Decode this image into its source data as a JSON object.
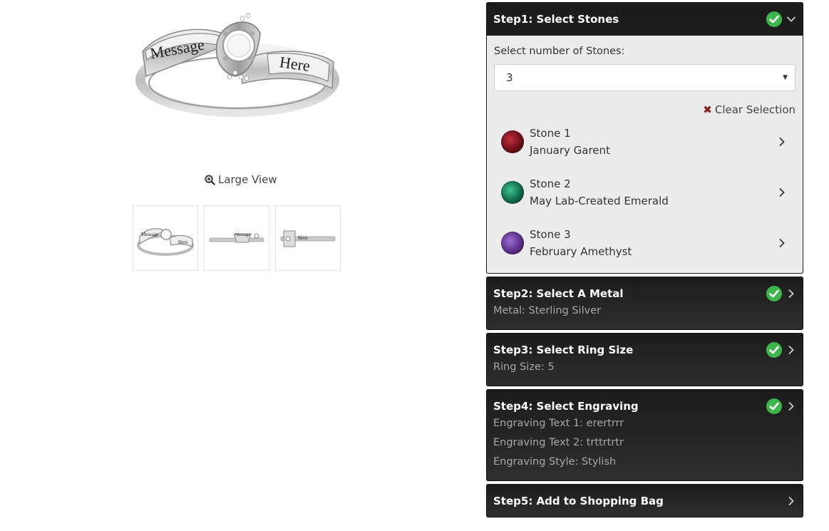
{
  "product": {
    "large_view_label": "Large View",
    "engraving_preview": [
      "Message",
      "Here"
    ]
  },
  "steps": [
    {
      "title": "Step1: Select Stones",
      "completed": true,
      "expanded": true
    },
    {
      "title": "Step2: Select A Metal",
      "completed": true,
      "lines": [
        "Metal: Sterling Silver"
      ]
    },
    {
      "title": "Step3: Select Ring Size",
      "completed": true,
      "lines": [
        "Ring Size: 5"
      ]
    },
    {
      "title": "Step4: Select Engraving",
      "completed": true,
      "lines": [
        "Engraving Text 1: erertrrr",
        "Engraving Text 2: trttrtrtr",
        "Engraving Style: Stylish"
      ]
    },
    {
      "title": "Step5: Add to Shopping Bag",
      "completed": false
    }
  ],
  "stones_step": {
    "label": "Select number of Stones:",
    "selected_count": "3",
    "clear_label": "Clear Selection",
    "stones": [
      {
        "name": "Stone 1",
        "gem": "January Garent",
        "color": "#6b0f18"
      },
      {
        "name": "Stone 2",
        "gem": "May Lab-Created Emerald",
        "color": "#0f6a4a"
      },
      {
        "name": "Stone 3",
        "gem": "February Amethyst",
        "color": "#5b2f86"
      }
    ]
  },
  "colors": {
    "check_green": "#3cb54a",
    "step_bg": "#1f1f1f",
    "body_bg": "#ececec"
  }
}
